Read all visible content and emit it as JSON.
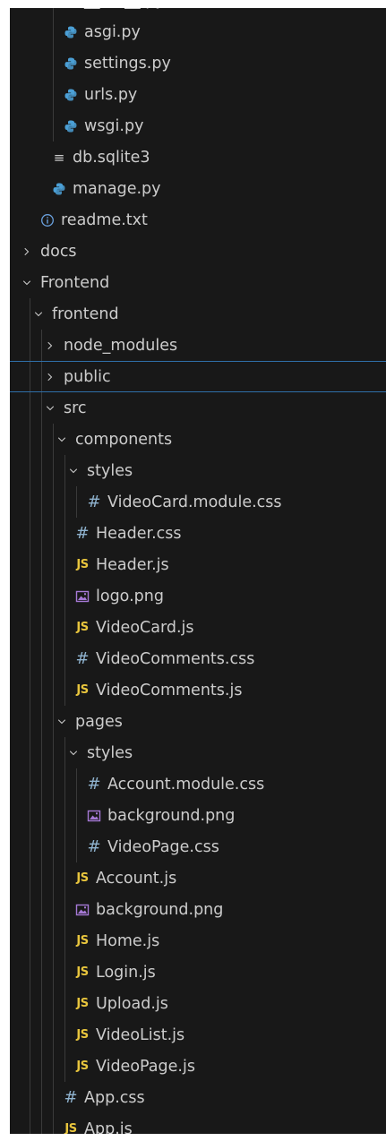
{
  "tree": [
    {
      "label": "__init__.py",
      "icon": "python",
      "depth": 3
    },
    {
      "label": "asgi.py",
      "icon": "python",
      "depth": 3
    },
    {
      "label": "settings.py",
      "icon": "python",
      "depth": 3
    },
    {
      "label": "urls.py",
      "icon": "python",
      "depth": 3
    },
    {
      "label": "wsgi.py",
      "icon": "python",
      "depth": 3
    },
    {
      "label": "db.sqlite3",
      "icon": "database-list",
      "depth": 2
    },
    {
      "label": "manage.py",
      "icon": "python",
      "depth": 2
    },
    {
      "label": "readme.txt",
      "icon": "info",
      "depth": 1
    },
    {
      "label": "docs",
      "folder": "collapsed",
      "depth": 0
    },
    {
      "label": "Frontend",
      "folder": "expanded",
      "depth": 0
    },
    {
      "label": "frontend",
      "folder": "expanded",
      "depth": 1
    },
    {
      "label": "node_modules",
      "folder": "collapsed",
      "depth": 2
    },
    {
      "label": "public",
      "folder": "collapsed",
      "depth": 2,
      "focused": true
    },
    {
      "label": "src",
      "folder": "expanded",
      "depth": 2
    },
    {
      "label": "components",
      "folder": "expanded",
      "depth": 3
    },
    {
      "label": "styles",
      "folder": "expanded",
      "depth": 4
    },
    {
      "label": "VideoCard.module.css",
      "icon": "css",
      "depth": 5
    },
    {
      "label": "Header.css",
      "icon": "css",
      "depth": 4
    },
    {
      "label": "Header.js",
      "icon": "js",
      "depth": 4
    },
    {
      "label": "logo.png",
      "icon": "image",
      "depth": 4
    },
    {
      "label": "VideoCard.js",
      "icon": "js",
      "depth": 4
    },
    {
      "label": "VideoComments.css",
      "icon": "css",
      "depth": 4
    },
    {
      "label": "VideoComments.js",
      "icon": "js",
      "depth": 4
    },
    {
      "label": "pages",
      "folder": "expanded",
      "depth": 3
    },
    {
      "label": "styles",
      "folder": "expanded",
      "depth": 4
    },
    {
      "label": "Account.module.css",
      "icon": "css",
      "depth": 5
    },
    {
      "label": "background.png",
      "icon": "image",
      "depth": 5
    },
    {
      "label": "VideoPage.css",
      "icon": "css",
      "depth": 5
    },
    {
      "label": "Account.js",
      "icon": "js",
      "depth": 4
    },
    {
      "label": "background.png",
      "icon": "image",
      "depth": 4
    },
    {
      "label": "Home.js",
      "icon": "js",
      "depth": 4
    },
    {
      "label": "Login.js",
      "icon": "js",
      "depth": 4
    },
    {
      "label": "Upload.js",
      "icon": "js",
      "depth": 4
    },
    {
      "label": "VideoList.js",
      "icon": "js",
      "depth": 4
    },
    {
      "label": "VideoPage.js",
      "icon": "js",
      "depth": 4
    },
    {
      "label": "App.css",
      "icon": "css",
      "depth": 3
    },
    {
      "label": "App.js",
      "icon": "js",
      "depth": 3
    }
  ],
  "colors": {
    "background": "#181818",
    "text": "#cccccc",
    "python": "#4b9fd5",
    "js": "#e8c53d",
    "css": "#8fb3cf",
    "image": "#a679d6",
    "focus": "#2f6fa8",
    "guide": "#3a3a3a"
  },
  "icon_glyphs": {
    "js": "JS",
    "css": "#",
    "database-list": "≡"
  }
}
